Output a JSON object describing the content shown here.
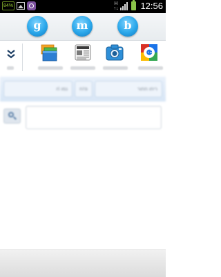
{
  "status_bar": {
    "battery_percent": "84%",
    "network_type_top": "H",
    "network_type_bottom": "↑↓",
    "time": "12:56",
    "notification_icons": [
      "gallery-icon",
      "viber-icon"
    ]
  },
  "shortcuts": [
    {
      "letter": "g",
      "icon": "circle-letter-g"
    },
    {
      "letter": "m",
      "icon": "circle-letter-m"
    },
    {
      "letter": "b",
      "icon": "circle-letter-b"
    }
  ],
  "apps": {
    "collapse_icon": "double-chevron-down",
    "items": [
      {
        "icon": "windows-app-icon"
      },
      {
        "icon": "news-app-icon"
      },
      {
        "icon": "camera-app-icon"
      },
      {
        "icon": "google-search-app-icon"
      }
    ]
  },
  "contact_bar": {
    "left_text": "ri נמו",
    "middle_text": "פ!ח",
    "right_text": "ריחו חחור"
  },
  "search": {
    "icon": "search-icon",
    "placeholder": ""
  },
  "colors": {
    "status_bar": "#000000",
    "shortcut_accent": "#2aa7ea",
    "contact_bar": "#dfeaf7",
    "background": "#ffffff"
  }
}
